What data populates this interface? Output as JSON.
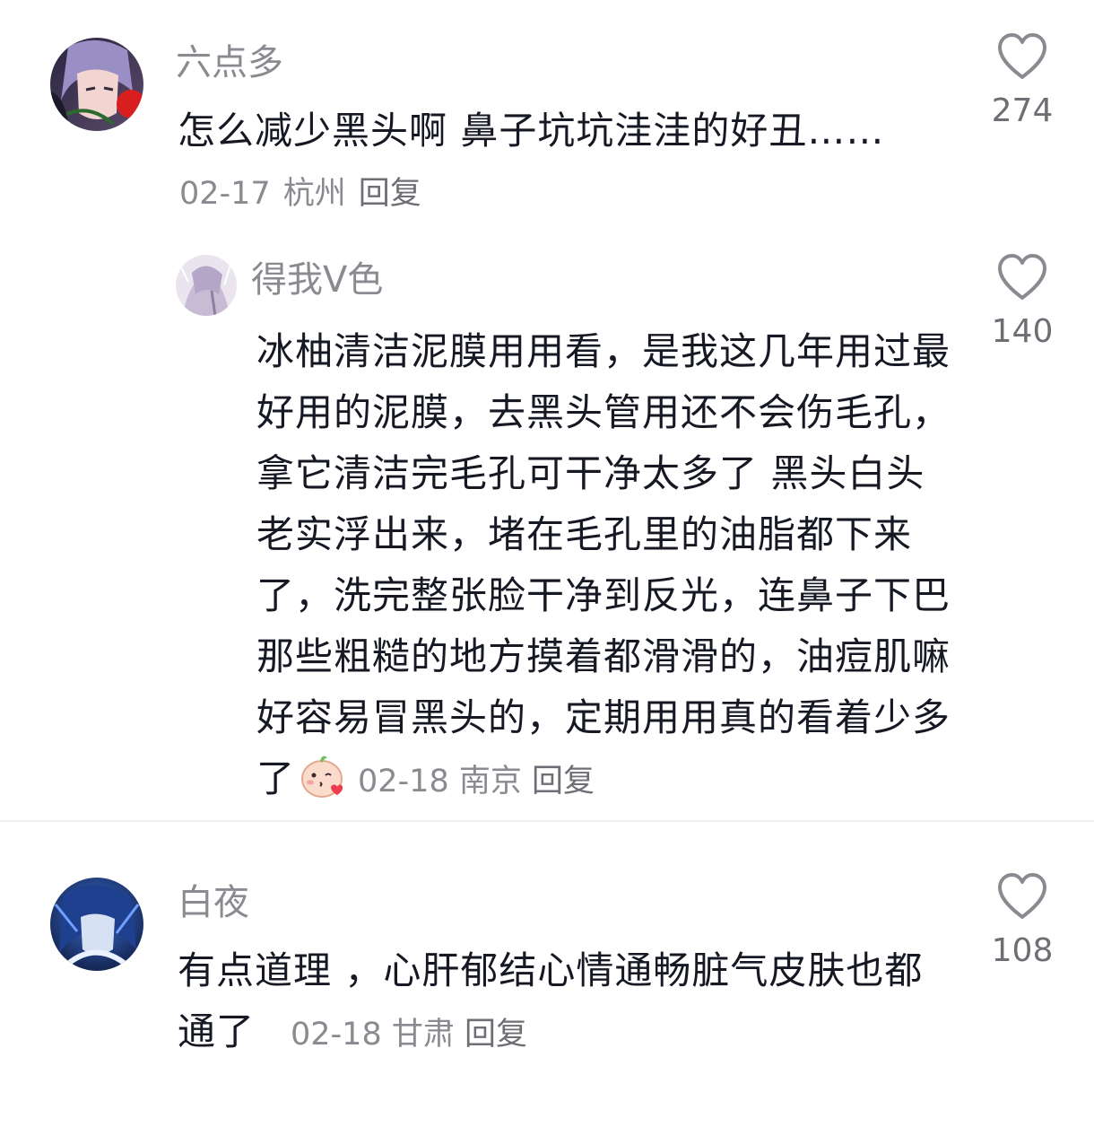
{
  "comments": [
    {
      "username": "六点多",
      "text": "怎么减少黑头啊 鼻子坑坑洼洼的好丑……",
      "date": "02-17",
      "location": "杭州",
      "reply_label": "回复",
      "likes": "274",
      "avatar_icon": "user-avatar-icon",
      "replies": [
        {
          "username": "得我V色",
          "text": "冰柚清洁泥膜用用看，是我这几年用过最好用的泥膜，去黑头管用还不会伤毛孔，拿它清洁完毛孔可干净太多了 黑头白头老实浮出来，堵在毛孔里的油脂都下来了，洗完整张脸干净到反光，连鼻子下巴那些粗糙的地方摸着都滑滑的，油痘肌嘛好容易冒黑头的，定期用用真的看着少多了",
          "emoji": "blowing-kiss-emoji",
          "date": "02-18",
          "location": "南京",
          "reply_label": "回复",
          "likes": "140"
        }
      ]
    },
    {
      "username": "白夜",
      "text": "有点道理 ，心肝郁结心情通畅脏气皮肤也都通了",
      "date": "02-18",
      "location": "甘肃",
      "reply_label": "回复",
      "likes": "108"
    }
  ],
  "icons": {
    "like": "heart-outline-icon"
  },
  "colors": {
    "text": "#161823",
    "secondary": "#8a8b91",
    "divider": "#efefef"
  }
}
